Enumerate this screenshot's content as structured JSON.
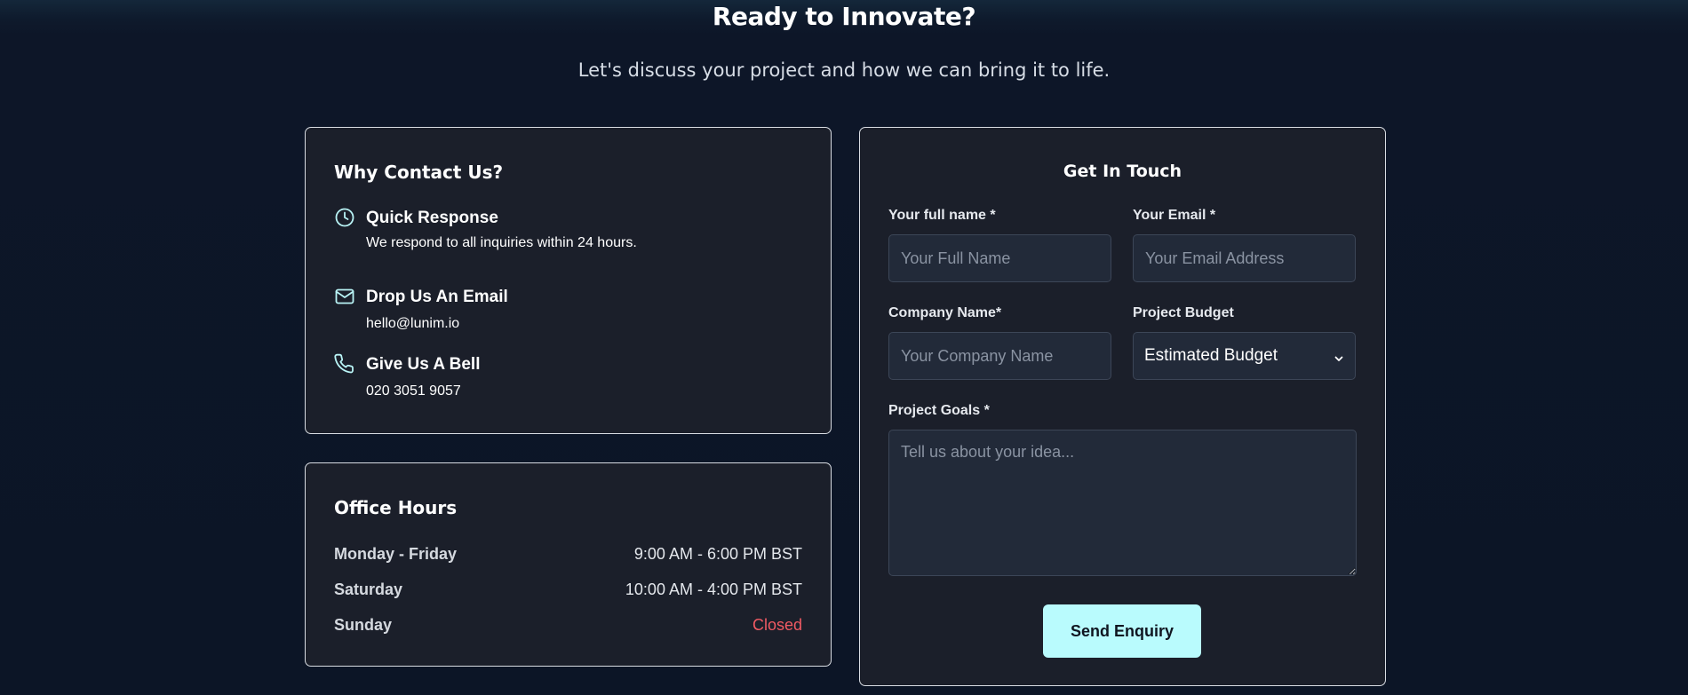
{
  "hero": {
    "title": "Ready to Innovate?",
    "subtitle": "Let's discuss your project and how we can bring it to life."
  },
  "why_contact": {
    "title": "Why Contact Us?",
    "items": [
      {
        "icon": "clock-icon",
        "heading": "Quick Response",
        "text": "We respond to all inquiries within 24 hours."
      },
      {
        "icon": "mail-icon",
        "heading": "Drop Us An Email",
        "text": "hello@lunim.io"
      },
      {
        "icon": "phone-icon",
        "heading": "Give Us A Bell",
        "text": "020 3051 9057"
      }
    ]
  },
  "office_hours": {
    "title": "Office Hours",
    "rows": [
      {
        "day": "Monday - Friday",
        "time": "9:00 AM - 6:00 PM BST"
      },
      {
        "day": "Saturday",
        "time": "10:00 AM - 4:00 PM BST"
      },
      {
        "day": "Sunday",
        "time": "Closed"
      }
    ]
  },
  "form": {
    "title": "Get In Touch",
    "full_name": {
      "label": "Your full name *",
      "placeholder": "Your Full Name",
      "value": ""
    },
    "email": {
      "label": "Your Email *",
      "placeholder": "Your Email Address",
      "value": ""
    },
    "company": {
      "label": "Company Name*",
      "placeholder": "Your Company Name",
      "value": ""
    },
    "budget": {
      "label": "Project Budget",
      "selected": "Estimated Budget"
    },
    "goals": {
      "label": "Project Goals *",
      "placeholder": "Tell us about your idea...",
      "value": ""
    },
    "submit_label": "Send Enquiry"
  },
  "colors": {
    "background": "#0c1526",
    "card": "#1b1f2a",
    "accent_button": "#b9fbfd",
    "closed_red": "#f05a63",
    "icon_cyan": "#b9f4f6"
  }
}
